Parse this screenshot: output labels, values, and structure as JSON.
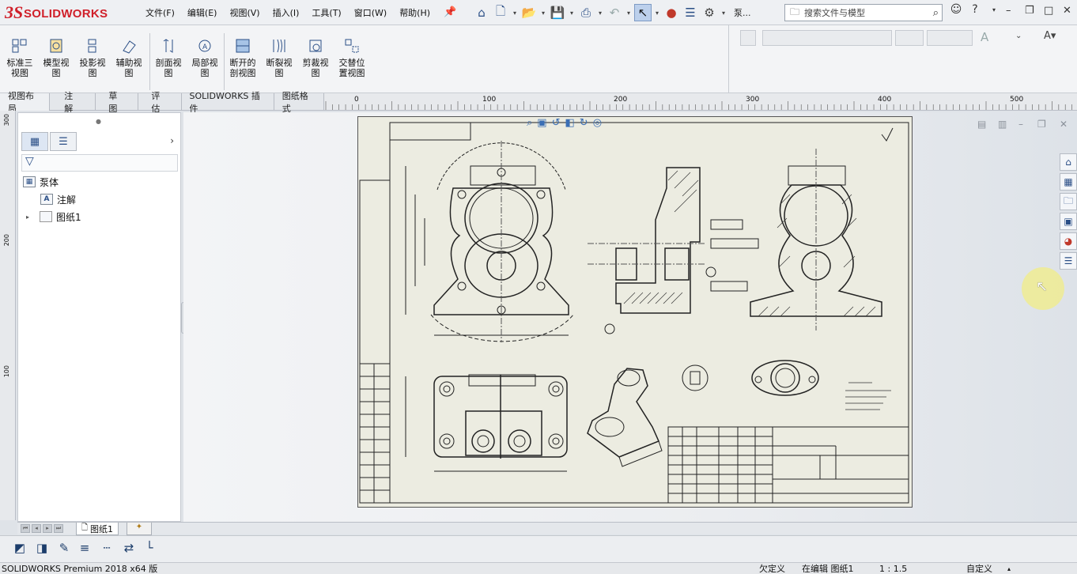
{
  "app": {
    "logo_mark": "3S",
    "logo_text": "SOLIDWORKS"
  },
  "menu": [
    "文件(F)",
    "编辑(E)",
    "视图(V)",
    "插入(I)",
    "工具(T)",
    "窗口(W)",
    "帮助(H)"
  ],
  "quick_toolbar": {
    "doc_name": "泵..."
  },
  "search": {
    "placeholder": "搜索文件与模型"
  },
  "ribbon": {
    "buttons": [
      {
        "label": "标准三视图",
        "icon": "standard-3-view-icon"
      },
      {
        "label": "模型视图",
        "icon": "model-view-icon"
      },
      {
        "label": "投影视图",
        "icon": "projected-view-icon"
      },
      {
        "label": "辅助视图",
        "icon": "auxiliary-view-icon"
      },
      {
        "label": "剖面视图",
        "icon": "section-view-icon"
      },
      {
        "label": "局部视图",
        "icon": "detail-view-icon"
      },
      {
        "label": "断开的剖视图",
        "icon": "broken-out-section-icon"
      },
      {
        "label": "断裂视图",
        "icon": "break-view-icon"
      },
      {
        "label": "剪裁视图",
        "icon": "crop-view-icon"
      },
      {
        "label": "交替位置视图",
        "icon": "alternate-position-view-icon"
      }
    ]
  },
  "tabs": [
    "视图布局",
    "注解",
    "草图",
    "评估",
    "SOLIDWORKS 插件",
    "图纸格式"
  ],
  "active_tab": "视图布局",
  "ruler": {
    "h_ticks": [
      "0",
      "100",
      "200",
      "300",
      "400",
      "500"
    ],
    "v_ticks": [
      "300",
      "200",
      "100"
    ]
  },
  "tree": {
    "root": "泵体",
    "items": [
      {
        "label": "注解",
        "icon": "annotations-icon"
      },
      {
        "label": "图纸1",
        "icon": "sheet-icon"
      }
    ]
  },
  "sheet_tab": {
    "label": "图纸1"
  },
  "status": {
    "product": "SOLIDWORKS Premium 2018 x64 版",
    "defined": "欠定义",
    "editing": "在编辑 图纸1",
    "scale": "1 : 1.5",
    "units": "自定义"
  },
  "colors": {
    "accent": "#d0202a",
    "icon_blue": "#2a4e86",
    "sheet_bg": "#ecece1"
  }
}
